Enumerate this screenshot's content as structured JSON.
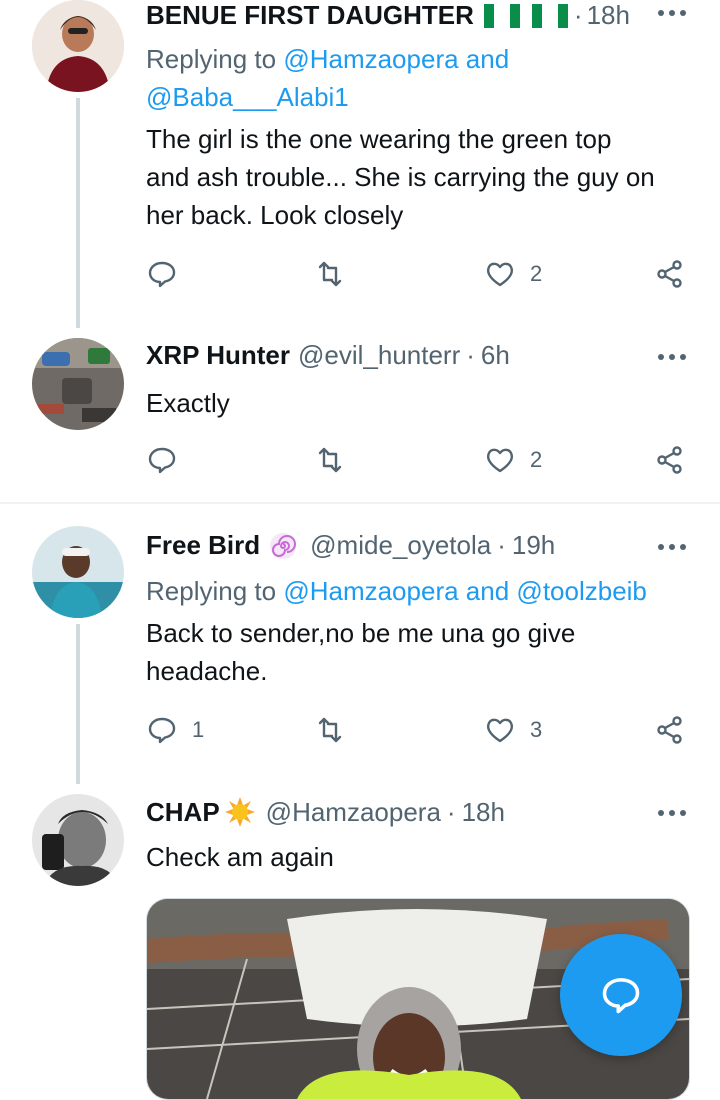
{
  "tweets": [
    {
      "name": "BENUE FIRST DAUGHTER",
      "handle": "",
      "time": "18h",
      "replying_prefix": "Replying to",
      "mention1": "@Hamzaopera",
      "and": "and",
      "mention2": "@Baba___Alabi1",
      "text_line1": "The girl is the one wearing the green top",
      "text_line2": "and ash trouble... She is carrying the guy on",
      "text_line3": "her back. Look closely",
      "replies": "",
      "likes": "2"
    },
    {
      "name": "XRP Hunter",
      "handle": "@evil_hunterr",
      "time": "6h",
      "text_line1": "Exactly",
      "likes": "2"
    },
    {
      "name": "Free Bird",
      "handle": "@mide_oyetola",
      "time": "19h",
      "replying_prefix": "Replying to",
      "mention1": "@Hamzaopera",
      "and": "and",
      "mention2": "@toolzbeib",
      "text_line1": "Back to sender,no be me una go give",
      "text_line2": "headache.",
      "replies": "1",
      "likes": "3"
    },
    {
      "name": "CHAP",
      "handle": "@Hamzaopera",
      "time": "18h",
      "text_line1": "Check am again"
    }
  ],
  "separator_dot": "·",
  "colors": {
    "accent": "#1d9bf0",
    "secondary_text": "#536471",
    "flag_green": "#008751"
  },
  "icons": [
    "reply-icon",
    "retweet-icon",
    "like-icon",
    "share-icon",
    "more-icon",
    "compose-reply-icon",
    "sun-emoji",
    "swirl-emoji",
    "flag-emoji"
  ]
}
